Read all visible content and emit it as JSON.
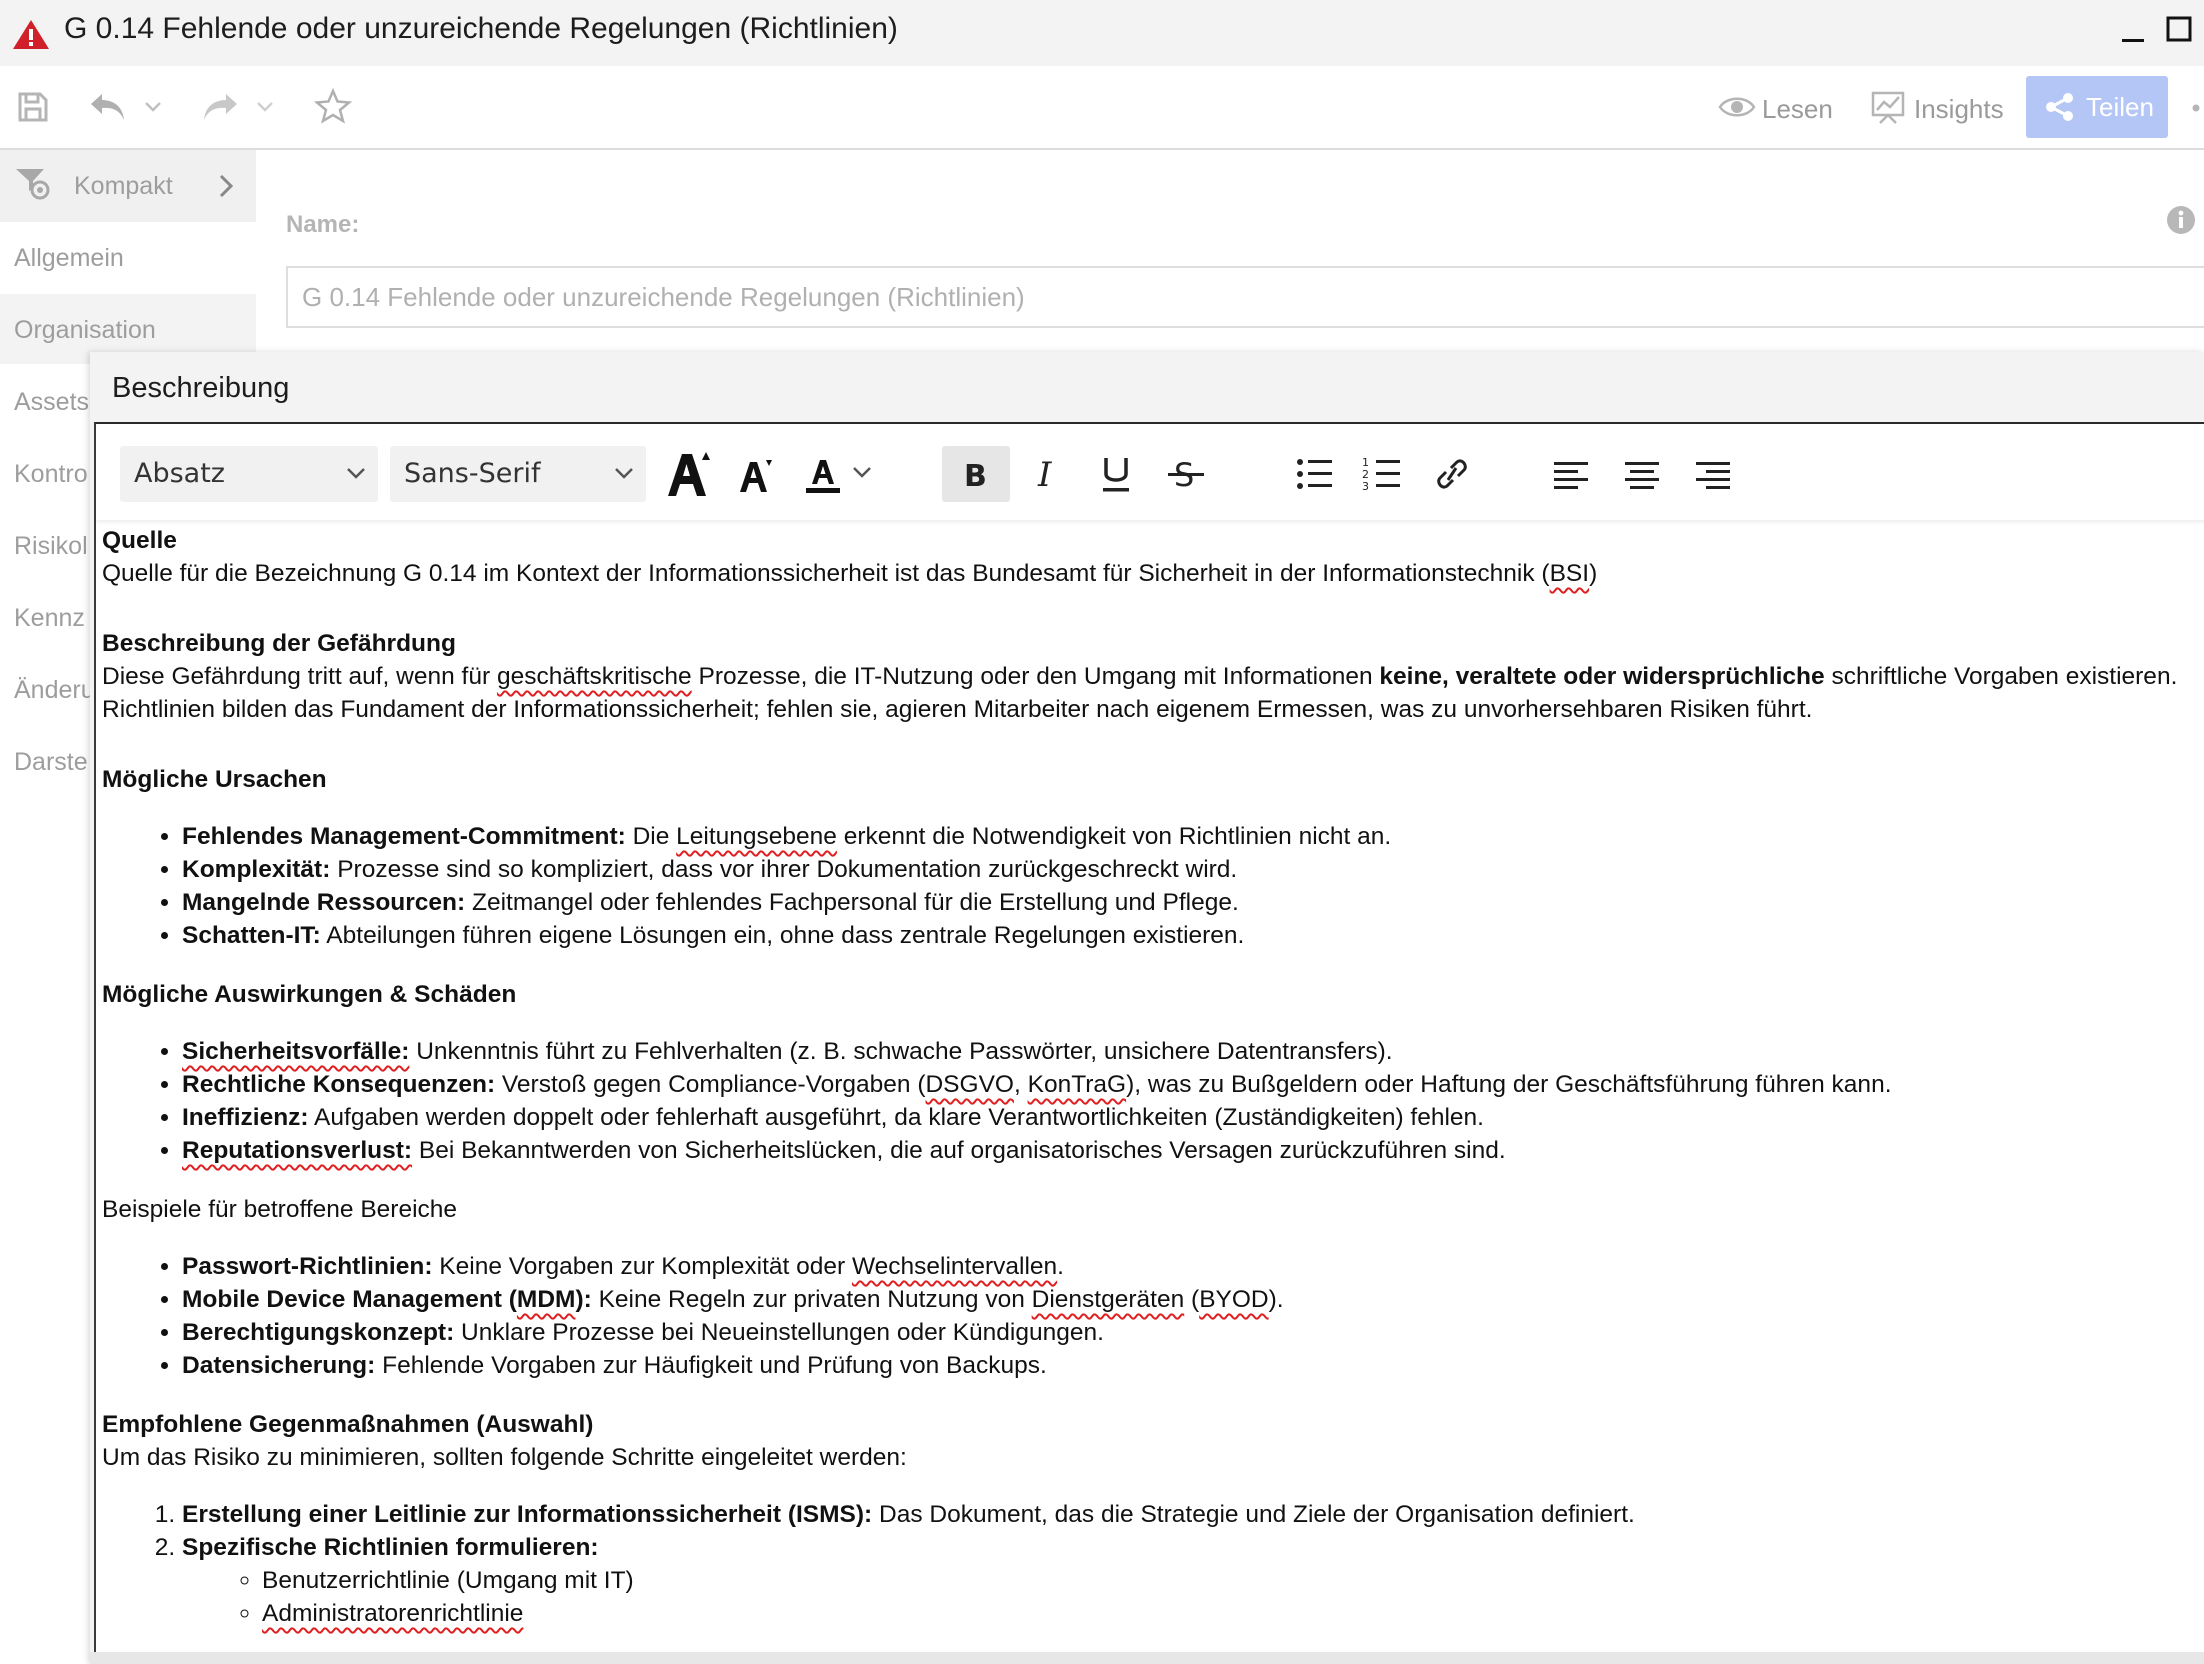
{
  "window": {
    "title": "G 0.14 Fehlende oder unzureichende Regelungen (Richtlinien)"
  },
  "toolbar": {
    "read_label": "Lesen",
    "insights_label": "Insights",
    "share_label": "Teilen"
  },
  "sidebar": {
    "compact_label": "Kompakt",
    "items": [
      {
        "label": "Allgemein"
      },
      {
        "label": "Organisation"
      },
      {
        "label": "Assets"
      },
      {
        "label": "Kontro"
      },
      {
        "label": "Risikol"
      },
      {
        "label": "Kennz"
      },
      {
        "label": "Änderu"
      },
      {
        "label": "Darste"
      }
    ]
  },
  "form": {
    "name_label": "Name:",
    "name_value": "G 0.14 Fehlende oder unzureichende Regelungen (Richtlinien)"
  },
  "dialog": {
    "title": "Beschreibung",
    "format_select": "Absatz",
    "font_select": "Sans-Serif"
  },
  "content": {
    "source_heading": "Quelle",
    "source_text_1": "Quelle für die Bezeichnung G 0.14 im Kontext der Informationssicherheit ist das Bundesamt für Sicherheit in der Informationstechnik (",
    "source_text_bsi": "BSI",
    "source_text_2": ")",
    "threat_heading": "Beschreibung der Gefährdung",
    "threat_1": "Diese Gefährdung tritt auf, wenn für ",
    "threat_sp": "geschäftskritische",
    "threat_2": " Prozesse, die IT-Nutzung oder den Umgang mit Informationen ",
    "threat_bold": "keine, veraltete oder widersprüchliche",
    "threat_3": " schriftliche Vorgaben existieren.",
    "threat_line2": "Richtlinien bilden das Fundament der Informationssicherheit; fehlen sie, agieren Mitarbeiter nach eigenem Ermessen, was zu unvorhersehbaren Risiken führt.",
    "causes_heading": "Mögliche Ursachen",
    "cause_1_bold": "Fehlendes Management-Commitment:",
    "cause_1_a": " Die ",
    "cause_1_sp": "Leitungsebene",
    "cause_1_b": " erkennt die Notwendigkeit von Richtlinien nicht an.",
    "cause_2_bold": "Komplexität:",
    "cause_2": " Prozesse sind so kompliziert, dass vor ihrer Dokumentation zurückgeschreckt wird.",
    "cause_3_bold": "Mangelnde Ressourcen:",
    "cause_3": " Zeitmangel oder fehlendes Fachpersonal für die Erstellung und Pflege.",
    "cause_4_bold": "Schatten-IT:",
    "cause_4": " Abteilungen führen eigene Lösungen ein, ohne dass zentrale Regelungen existieren.",
    "effects_heading": "Mögliche Auswirkungen & Schäden",
    "effect_1_bold": "Sicherheitsvorfälle:",
    "effect_1": " Unkenntnis führt zu Fehlverhalten (z. B. schwache Passwörter, unsichere Datentransfers).",
    "effect_2_bold": "Rechtliche Konsequenzen:",
    "effect_2_a": " Verstoß gegen Compliance-Vorgaben (",
    "effect_2_sp1": "DSGVO",
    "effect_2_b": ", ",
    "effect_2_sp2": "KonTraG",
    "effect_2_c": "), was zu Bußgeldern oder Haftung der Geschäftsführung führen kann.",
    "effect_3_bold": "Ineffizienz:",
    "effect_3": " Aufgaben werden doppelt oder fehlerhaft ausgeführt, da klare Verantwortlichkeiten (Zuständigkeiten) fehlen.",
    "effect_4_bold": "Reputationsverlust:",
    "effect_4": " Bei Bekanntwerden von Sicherheitslücken, die auf organisatorisches Versagen zurückzuführen sind.",
    "examples_heading": "Beispiele für betroffene Bereiche",
    "ex_1_bold": "Passwort-Richtlinien:",
    "ex_1_a": " Keine Vorgaben zur Komplexität oder ",
    "ex_1_sp": "Wechselintervallen",
    "ex_1_b": ".",
    "ex_2_bold_a": "Mobile Device Management (",
    "ex_2_bold_sp": "MDM",
    "ex_2_bold_b": "):",
    "ex_2_a": " Keine Regeln zur privaten Nutzung von ",
    "ex_2_sp1": "Dienstgeräten",
    "ex_2_b": " (",
    "ex_2_sp2": "BYOD",
    "ex_2_c": ").",
    "ex_3_bold": "Berechtigungskonzept:",
    "ex_3": " Unklare Prozesse bei Neueinstellungen oder Kündigungen.",
    "ex_4_bold": "Datensicherung:",
    "ex_4": " Fehlende Vorgaben zur Häufigkeit und Prüfung von Backups.",
    "measures_heading": "Empfohlene Gegenmaßnahmen (Auswahl)",
    "measures_intro": "Um das Risiko zu minimieren, sollten folgende Schritte eingeleitet werden:",
    "measure_1_bold": "Erstellung einer Leitlinie zur Informationssicherheit (ISMS):",
    "measure_1": " Das Dokument, das die Strategie und Ziele der Organisation definiert.",
    "measure_2_bold": "Spezifische Richtlinien formulieren:",
    "sub_1": "Benutzerrichtlinie (Umgang mit IT)",
    "sub_2": "Administratorenrichtlinie"
  }
}
